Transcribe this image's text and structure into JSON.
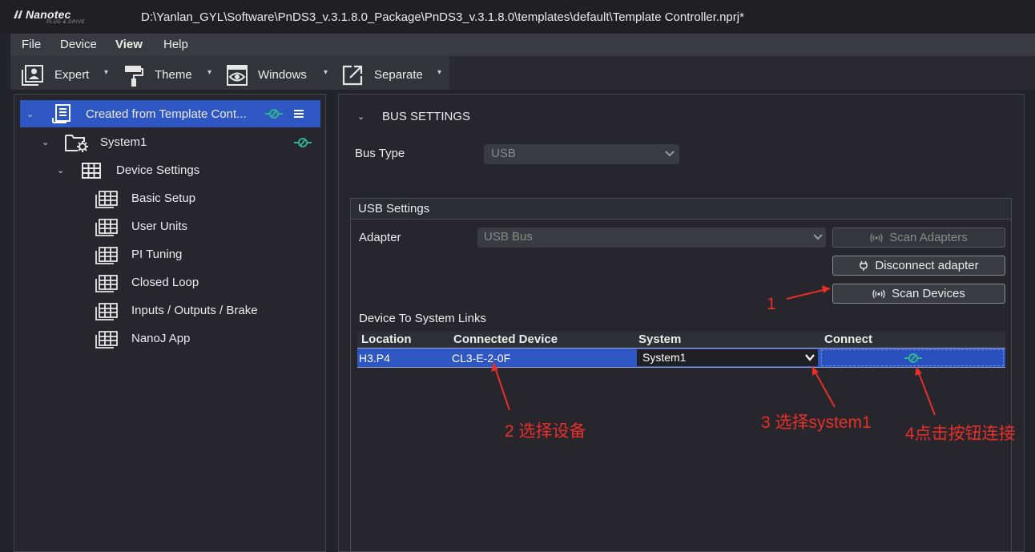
{
  "window": {
    "logo": "Nanotec",
    "logo_tagline": "PLUG & DRIVE",
    "title": "D:\\Yanlan_GYL\\Software\\PnDS3_v.3.1.8.0_Package\\PnDS3_v.3.1.8.0\\templates\\default\\Template Controller.nprj*"
  },
  "menu": {
    "items": [
      "File",
      "Device",
      "View",
      "Help"
    ],
    "active": "View"
  },
  "toolbar": {
    "items": [
      {
        "label": "Expert",
        "icon": "user-frame-icon"
      },
      {
        "label": "Theme",
        "icon": "paint-roller-icon"
      },
      {
        "label": "Windows",
        "icon": "eye-window-icon"
      },
      {
        "label": "Separate",
        "icon": "external-link-icon"
      }
    ]
  },
  "tree": {
    "root": {
      "label": "Created from Template Cont...",
      "icon": "document-icon"
    },
    "system": {
      "label": "System1",
      "icon": "folder-gear-icon"
    },
    "device_settings": {
      "label": "Device Settings",
      "icon": "grid-icon"
    },
    "children": [
      {
        "label": "Basic Setup"
      },
      {
        "label": "User Units"
      },
      {
        "label": "PI Tuning"
      },
      {
        "label": "Closed Loop"
      },
      {
        "label": "Inputs / Outputs / Brake"
      },
      {
        "label": "NanoJ App"
      }
    ]
  },
  "bus_settings": {
    "section_title": "BUS SETTINGS",
    "bus_type_label": "Bus Type",
    "bus_type_value": "USB"
  },
  "usb_settings": {
    "group_title": "USB Settings",
    "adapter_label": "Adapter",
    "adapter_value": "USB Bus",
    "scan_adapters_label": "Scan Adapters",
    "disconnect_label": "Disconnect adapter",
    "scan_devices_label": "Scan Devices"
  },
  "links_table": {
    "title": "Device To System Links",
    "columns": [
      "Location",
      "Connected Device",
      "System",
      "Connect"
    ],
    "rows": [
      {
        "location": "H3.P4",
        "device": "CL3-E-2-0F",
        "system": "System1"
      }
    ]
  },
  "annotations": {
    "a1": "1",
    "a2": "2 选择设备",
    "a3": "3 选择system1",
    "a4": "4点击按钮连接"
  },
  "colors": {
    "selection": "#2f57c4",
    "connect_icon": "#2fb38a",
    "annotation": "#e8302a"
  }
}
